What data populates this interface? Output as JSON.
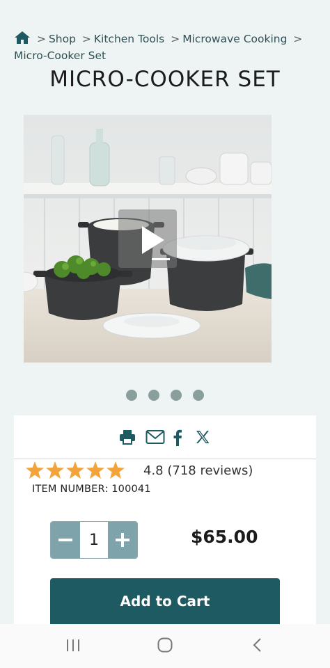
{
  "breadcrumb": {
    "home_icon": "home-icon",
    "separator": ">",
    "items": [
      "Shop",
      "Kitchen Tools",
      "Microwave Cooking"
    ],
    "current": "Micro-Cooker Set"
  },
  "product": {
    "title": "MICRO-COOKER SET",
    "image_alt": "Micro-Cooker Set product image with play button",
    "carousel_dot_count": 4,
    "rating": 4.8,
    "rating_text": "4.8 (718 reviews)",
    "item_number_label": "ITEM NUMBER: 100041",
    "quantity": "1",
    "price": "$65.00",
    "add_to_cart_label": "Add to Cart"
  },
  "share": {
    "icons": [
      "print-icon",
      "email-icon",
      "facebook-icon",
      "x-icon"
    ]
  },
  "colors": {
    "background": "#eef4f3",
    "accent": "#1e5a61",
    "star": "#f2a33a",
    "qty_button": "#7fa3aa"
  },
  "navbar": {
    "icons": [
      "recent-apps-icon",
      "home-nav-icon",
      "back-icon"
    ]
  }
}
